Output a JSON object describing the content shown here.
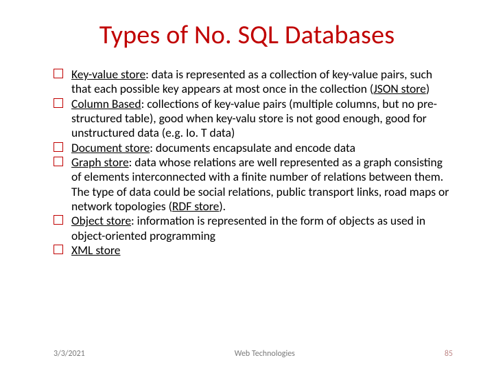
{
  "title": "Types of No. SQL Databases",
  "items": [
    {
      "lead": "Key-value store",
      "rest": ": data is represented as a collection of key-value pairs, such that each possible key appears at most once in the collection (",
      "paren": "JSON store",
      "tail": ")"
    },
    {
      "lead": "Column Based",
      "rest": ": collections of key-value pairs (multiple columns, but no pre-structured table), good when key-valu store is not good enough, good for unstructured data (e.g. Io. T data)",
      "paren": "",
      "tail": ""
    },
    {
      "lead": "Document store",
      "rest": ": documents encapsulate and encode data",
      "paren": "",
      "tail": ""
    },
    {
      "lead": "Graph store",
      "rest": ": data whose relations are well represented as a graph consisting of elements interconnected with a finite number of relations between them. The type of data could be social relations, public transport links, road maps or network topologies (",
      "paren": "RDF store",
      "tail": ")."
    },
    {
      "lead": "Object store",
      "rest": ": information is represented in the form of objects as used in object-oriented programming",
      "paren": "",
      "tail": ""
    },
    {
      "lead": "XML store",
      "rest": "",
      "paren": "",
      "tail": ""
    }
  ],
  "footer": {
    "date": "3/3/2021",
    "center": "Web Technologies",
    "page": "85"
  }
}
